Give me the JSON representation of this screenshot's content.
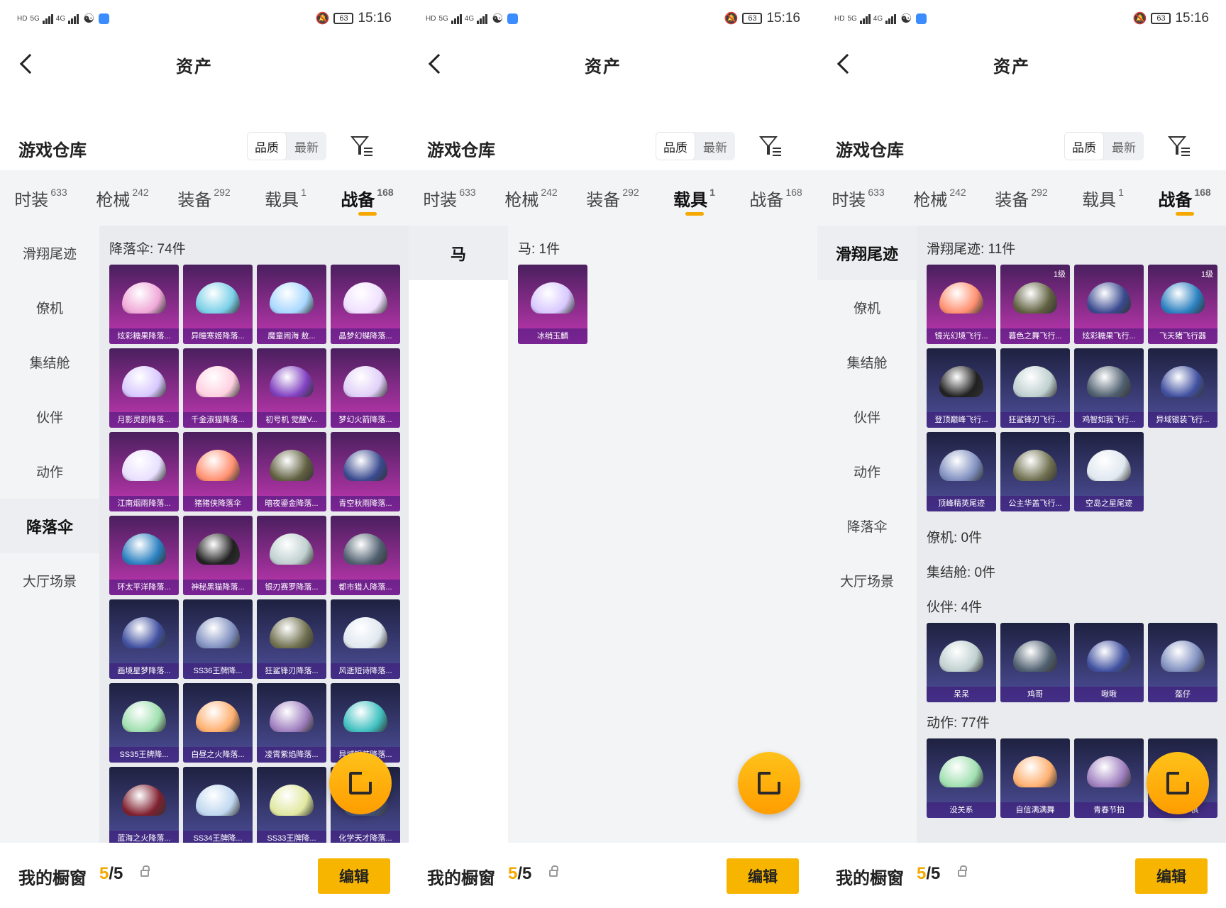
{
  "status": {
    "time": "15:16",
    "battery": "63",
    "left_labels": [
      "HD",
      "5G",
      "4G"
    ]
  },
  "header": {
    "title": "资产"
  },
  "warehouse": {
    "title": "游戏仓库",
    "sort_quality": "品质",
    "sort_latest": "最新"
  },
  "tabs": [
    {
      "label": "时装",
      "count": "633"
    },
    {
      "label": "枪械",
      "count": "242"
    },
    {
      "label": "装备",
      "count": "292"
    },
    {
      "label": "载具",
      "count": "1"
    },
    {
      "label": "战备",
      "count": "168"
    }
  ],
  "sidebar_combat": [
    "滑翔尾迹",
    "僚机",
    "集结舱",
    "伙伴",
    "动作",
    "降落伞",
    "大厅场景"
  ],
  "sidebar_vehicle": [
    "马"
  ],
  "screen1": {
    "section": "降落伞: 74件",
    "items": [
      "炫彩糖果降落...",
      "异瞳寒姬降落...",
      "魔童闹海 敖...",
      "晶梦幻蝶降落...",
      "月影灵韵降落...",
      "千金淑猫降落...",
      "初号机 觉醒V...",
      "梦幻火箭降落...",
      "江南烟雨降落...",
      "猪猪侠降落伞",
      "暗夜鎏金降落...",
      "青空秋雨降落...",
      "环太平洋降落...",
      "神秘黑猫降落...",
      "银刃赛罗降落...",
      "都市猎人降落...",
      "画境星梦降落...",
      "SS36王牌降...",
      "狂鲨锋刃降落...",
      "风逝短诗降落...",
      "SS35王牌降...",
      "白昼之火降落...",
      "凌霄紫焰降落...",
      "异域银装降落...",
      "蓝海之火降落...",
      "SS34王牌降...",
      "SS33王牌降...",
      "化学天才降落..."
    ]
  },
  "screen2": {
    "section": "马: 1件",
    "items": [
      "冰绡玉麟"
    ]
  },
  "screen3": {
    "trail_section": "滑翔尾迹: 11件",
    "trail_items": [
      "镜光幻境飞行...",
      "暮色之舞飞行...",
      "炫彩糖果飞行...",
      "飞天猪飞行器",
      "登顶巅峰飞行...",
      "狂鲨锋刃飞行...",
      "鸡智如我飞行...",
      "异域银装飞行...",
      "顶峰精英尾迹",
      "公主华盖飞行...",
      "空岛之星尾迹"
    ],
    "trail_levels": [
      "",
      "1级",
      "",
      "1级"
    ],
    "wingman_section": "僚机: 0件",
    "pod_section": "集结舱: 0件",
    "partner_section": "伙伴: 4件",
    "partner_items": [
      "呆呆",
      "鸡哥",
      "啾啾",
      "盔仔"
    ],
    "action_section": "动作: 77件",
    "action_items": [
      "没关系",
      "自信满满舞",
      "青春节拍",
      "疾…子棋"
    ]
  },
  "bottom": {
    "title": "我的橱窗",
    "count_current": "5",
    "count_total": "/5",
    "edit_label": "编辑"
  },
  "colors": {
    "accent": "#f4a800",
    "purple_card": "#c338b3",
    "blue_card": "#4e4f9a"
  }
}
